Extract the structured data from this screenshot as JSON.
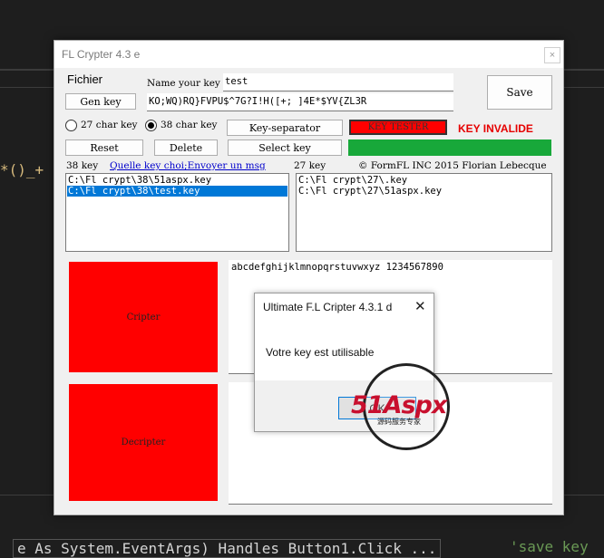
{
  "background": {
    "left_code": "*()_+",
    "bottom_code": "e As System.EventArgs) Handles Button1.Click ...",
    "right_code": "'save key"
  },
  "window": {
    "title": "FL Crypter 4.3 e",
    "close_glyph": "×",
    "menu_label": "Fichier",
    "name_label": "Name your key",
    "name_value": "test",
    "key_value": "KO;WQ)RQ}FVPU$^7G?I!H([+; ]4E*$YV{ZL3R",
    "save_label": "Save",
    "gen_key_label": "Gen key",
    "radio_27_label": "27 char key",
    "radio_38_label": "38 char key",
    "radio_selected": "38",
    "key_separator_label": "Key-separator",
    "key_tester_label": "KEY TESTER",
    "key_status": "KEY INVALIDE",
    "reset_label": "Reset",
    "delete_label": "Delete",
    "select_key_label": "Select key",
    "label_38": "38 key",
    "link_choice": "Quelle key choi",
    "link_separator": ";",
    "link_send": "Envoyer un msg",
    "label_27": "27 key",
    "copyright": "© FormFL INC 2015 Florian Lebecque",
    "list_38": [
      {
        "text": "C:\\Fl crypt\\38\\51aspx.key",
        "selected": false
      },
      {
        "text": "C:\\Fl crypt\\38\\test.key",
        "selected": true
      }
    ],
    "list_27": [
      {
        "text": "C:\\Fl crypt\\27\\.key",
        "selected": false
      },
      {
        "text": "C:\\Fl crypt\\27\\51aspx.key",
        "selected": false
      }
    ],
    "cripter_label": "Cripter",
    "decripter_label": "Decripter",
    "plain_text": "abcdefghijklmnopqrstuvwxyz 1234567890"
  },
  "dialog": {
    "title": "Ultimate F.L Cripter 4.3.1 d",
    "close_glyph": "✕",
    "message": "Votre key est utilisable",
    "ok_label": "OK"
  },
  "watermark": {
    "text": "51Aspx",
    "subtitle": "源码服务专家"
  },
  "colors": {
    "red": "#ff0000",
    "green": "#18a83a",
    "status_red": "#e60000",
    "selection": "#0078d7"
  }
}
